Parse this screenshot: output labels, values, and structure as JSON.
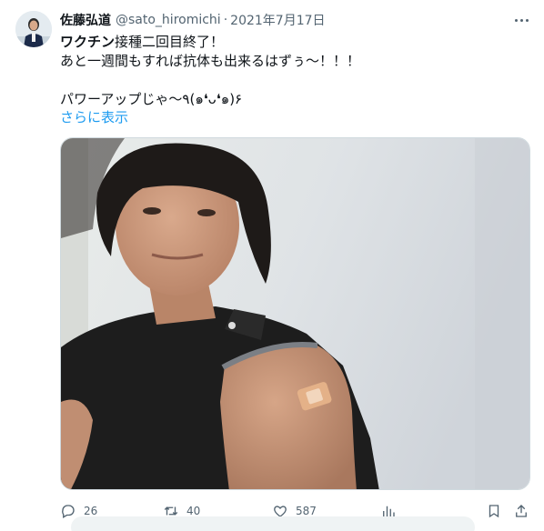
{
  "tweet": {
    "display_name": "佐藤弘道",
    "handle": "@sato_hiromichi",
    "separator": "·",
    "date": "2021年7月17日",
    "lines": [
      {
        "highlight": "ワクチン",
        "rest": "接種二回目終了！"
      },
      {
        "text": "あと一週間もすれば抗体も出来るはずぅ～！！！"
      },
      {
        "text": ""
      },
      {
        "text": "パワーアップじゃ～٩(๑❛ᴗ❛๑)۶"
      }
    ],
    "show_more": "さらに表示"
  },
  "actions": {
    "reply_count": "26",
    "retweet_count": "40",
    "like_count": "587"
  },
  "icons": [
    "more-icon",
    "reply-icon",
    "retweet-icon",
    "like-icon",
    "views-icon",
    "bookmark-icon",
    "share-icon"
  ],
  "colors": {
    "link": "#1d9bf0",
    "text": "#0f1419",
    "secondary": "#536471",
    "border": "#cfd9de"
  }
}
